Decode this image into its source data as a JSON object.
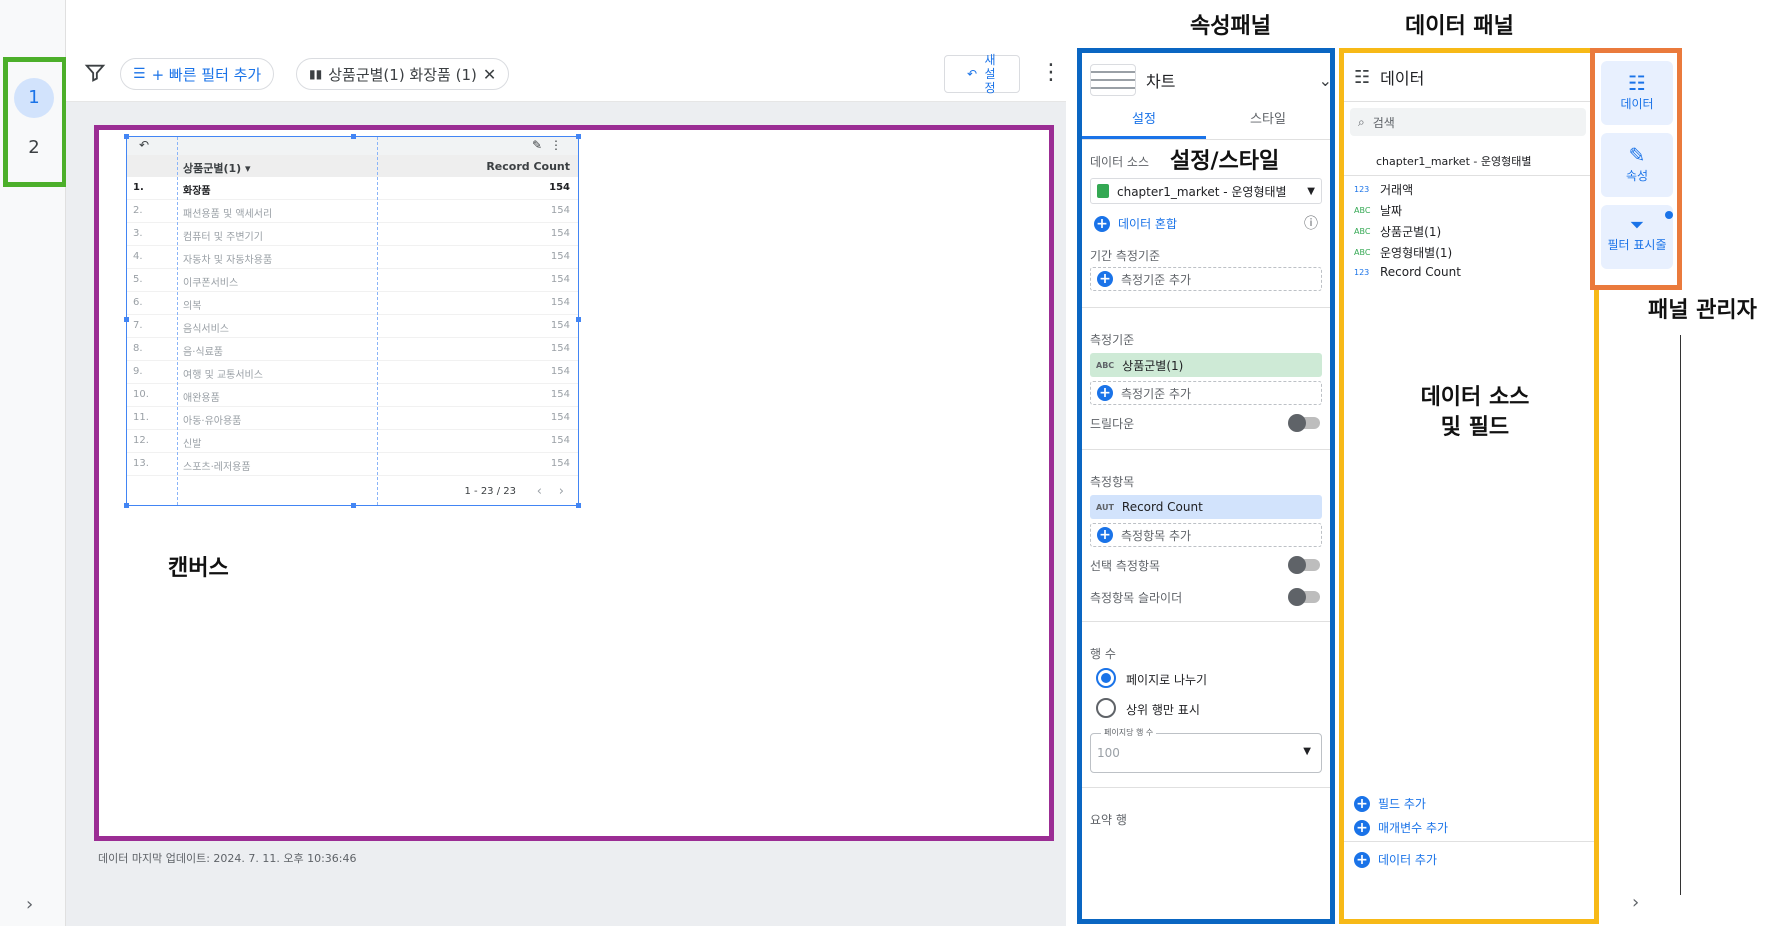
{
  "labels": {
    "props_panel": "속성패널",
    "data_panel": "데이터 패널",
    "settings_style": "설정/스타일",
    "panel_manager": "패널 관리자",
    "data_source_fields": "데이터 소스\n및 필드",
    "canvas": "캔버스"
  },
  "pages": [
    "1",
    "2"
  ],
  "filterbar": {
    "add_quick_filter": "+ 빠른 필터 추가",
    "active_filter": "상품군별(1) 화장품 (1)",
    "refresh_label": "새설정"
  },
  "table": {
    "headers": [
      "상품군별(1) ▾",
      "Record Count"
    ],
    "rows": [
      {
        "n": "1.",
        "cat": "화장품",
        "val": "154"
      },
      {
        "n": "2.",
        "cat": "패션용품 및 액세서리",
        "val": "154"
      },
      {
        "n": "3.",
        "cat": "컴퓨터 및 주변기기",
        "val": "154"
      },
      {
        "n": "4.",
        "cat": "자동차 및 자동차용품",
        "val": "154"
      },
      {
        "n": "5.",
        "cat": "이쿠폰서비스",
        "val": "154"
      },
      {
        "n": "6.",
        "cat": "의복",
        "val": "154"
      },
      {
        "n": "7.",
        "cat": "음식서비스",
        "val": "154"
      },
      {
        "n": "8.",
        "cat": "음·식료품",
        "val": "154"
      },
      {
        "n": "9.",
        "cat": "여행 및 교통서비스",
        "val": "154"
      },
      {
        "n": "10.",
        "cat": "애완용품",
        "val": "154"
      },
      {
        "n": "11.",
        "cat": "아동·유아용품",
        "val": "154"
      },
      {
        "n": "12.",
        "cat": "신발",
        "val": "154"
      },
      {
        "n": "13.",
        "cat": "스포츠·레저용품",
        "val": "154"
      }
    ],
    "pagination": "1 - 23 / 23"
  },
  "updated": "데이터 마지막 업데이트: 2024. 7. 11. 오후 10:36:46",
  "props": {
    "chart_type": "차트",
    "tabs": [
      "설정",
      "스타일"
    ],
    "data_source_title": "데이터 소스",
    "data_source": "chapter1_market - 운영형태별",
    "blend": "데이터 혼합",
    "date_dim_title": "기간 측정기준",
    "add_dimension": "측정기준 추가",
    "dimension_title": "측정기준",
    "dimension_field": "상품군별(1)",
    "drilldown": "드릴다운",
    "metric_title": "측정항목",
    "metric_field": "Record Count",
    "add_metric": "측정항목 추가",
    "optional_metric": "선택 측정항목",
    "metric_slider": "측정항목 슬라이더",
    "rows_title": "행 수",
    "paginate": "페이지로 나누기",
    "top_rows": "상위 행만 표시",
    "rows_per_page_label": "페이지당 행 수",
    "rows_per_page": "100",
    "summary_row": "요약 행",
    "abc": "ABC",
    "aut": "AUT"
  },
  "datap": {
    "title": "데이터",
    "search": "검색",
    "source": "chapter1_market - 운영형태별",
    "fields": [
      {
        "type": "123",
        "name": "거래액"
      },
      {
        "type": "ABC",
        "name": "날짜"
      },
      {
        "type": "ABC",
        "name": "상품군별(1)"
      },
      {
        "type": "ABC",
        "name": "운영형태별(1)"
      },
      {
        "type": "123",
        "name": "Record Count"
      }
    ],
    "add_field": "필드 추가",
    "add_param": "매개변수 추가",
    "add_data": "데이터 추가"
  },
  "pm": {
    "data": "데이터",
    "props": "속성",
    "filter": "필터 표시줄"
  }
}
